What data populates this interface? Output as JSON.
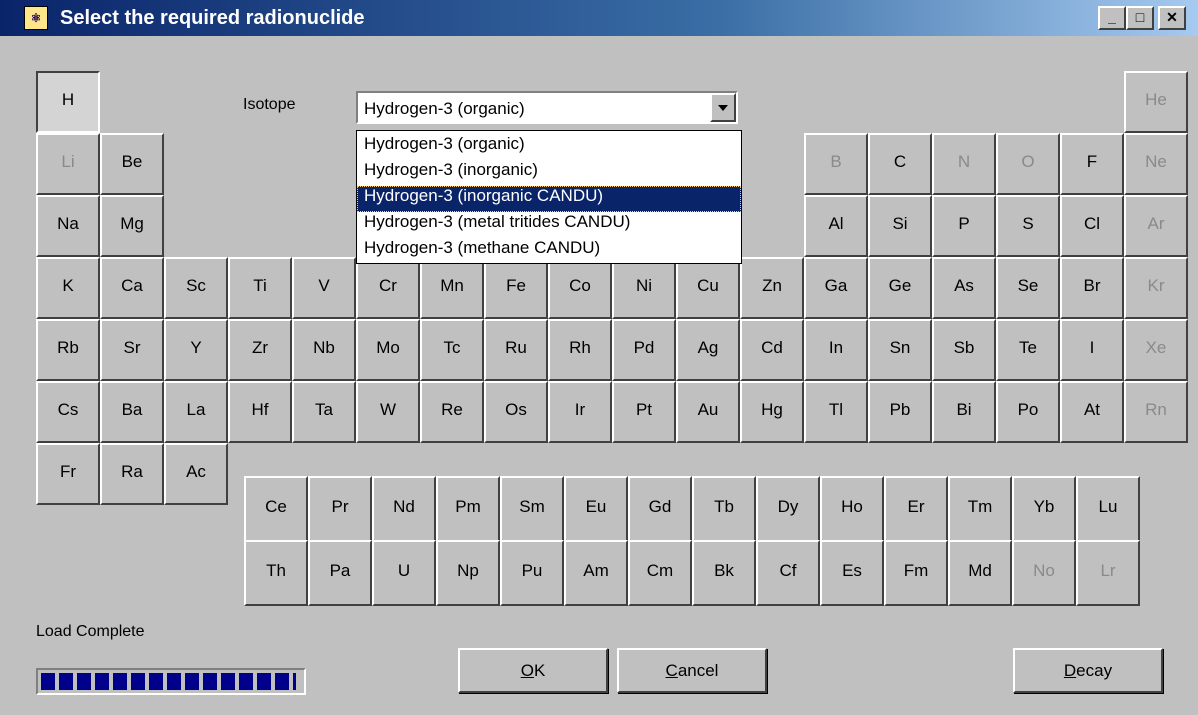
{
  "window": {
    "title": "Select the required radionuclide",
    "buttons": {
      "minimize": "_",
      "maximize": "□",
      "close": "✕"
    },
    "icon": "app-icon"
  },
  "isotope": {
    "label": "Isotope",
    "selected_value": "Hydrogen-3 (organic)",
    "options": [
      "Hydrogen-3 (organic)",
      "Hydrogen-3 (inorganic)",
      "Hydrogen-3 (inorganic CANDU)",
      "Hydrogen-3 (metal tritides CANDU)",
      "Hydrogen-3 (methane CANDU)"
    ],
    "highlighted_option": "Hydrogen-3 (inorganic CANDU)"
  },
  "selected_element": "H",
  "elements": {
    "row1": [
      "H",
      "He"
    ],
    "row2": [
      "Li",
      "Be",
      "B",
      "C",
      "N",
      "O",
      "F",
      "Ne"
    ],
    "row3": [
      "Na",
      "Mg",
      "Al",
      "Si",
      "P",
      "S",
      "Cl",
      "Ar"
    ],
    "row4": [
      "K",
      "Ca",
      "Sc",
      "Ti",
      "V",
      "Cr",
      "Mn",
      "Fe",
      "Co",
      "Ni",
      "Cu",
      "Zn",
      "Ga",
      "Ge",
      "As",
      "Se",
      "Br",
      "Kr"
    ],
    "row5": [
      "Rb",
      "Sr",
      "Y",
      "Zr",
      "Nb",
      "Mo",
      "Tc",
      "Ru",
      "Rh",
      "Pd",
      "Ag",
      "Cd",
      "In",
      "Sn",
      "Sb",
      "Te",
      "I",
      "Xe"
    ],
    "row6": [
      "Cs",
      "Ba",
      "La",
      "Hf",
      "Ta",
      "W",
      "Re",
      "Os",
      "Ir",
      "Pt",
      "Au",
      "Hg",
      "Tl",
      "Pb",
      "Bi",
      "Po",
      "At",
      "Rn"
    ],
    "row7": [
      "Fr",
      "Ra",
      "Ac"
    ],
    "lanthanides": [
      "Ce",
      "Pr",
      "Nd",
      "Pm",
      "Sm",
      "Eu",
      "Gd",
      "Tb",
      "Dy",
      "Ho",
      "Er",
      "Tm",
      "Yb",
      "Lu"
    ],
    "actinides": [
      "Th",
      "Pa",
      "U",
      "Np",
      "Pu",
      "Am",
      "Cm",
      "Bk",
      "Cf",
      "Es",
      "Fm",
      "Md",
      "No",
      "Lr"
    ]
  },
  "disabled_elements": [
    "He",
    "Li",
    "B",
    "N",
    "O",
    "Ne",
    "Ar",
    "Kr",
    "Xe",
    "Rn",
    "No",
    "Lr"
  ],
  "status": {
    "text": "Load Complete",
    "progress_fraction": 1.0,
    "progress_color": "#00008b"
  },
  "buttons": {
    "ok": {
      "accel": "O",
      "rest": "K"
    },
    "cancel": {
      "accel": "C",
      "rest": "ancel"
    },
    "decay": {
      "accel": "D",
      "rest": "ecay"
    }
  },
  "colors": {
    "title_bar_start": "#0a246a",
    "title_bar_end": "#a6caf0",
    "face": "#c0c0c0",
    "highlight": "#0a246a",
    "disabled_text": "#8a8a8a"
  }
}
